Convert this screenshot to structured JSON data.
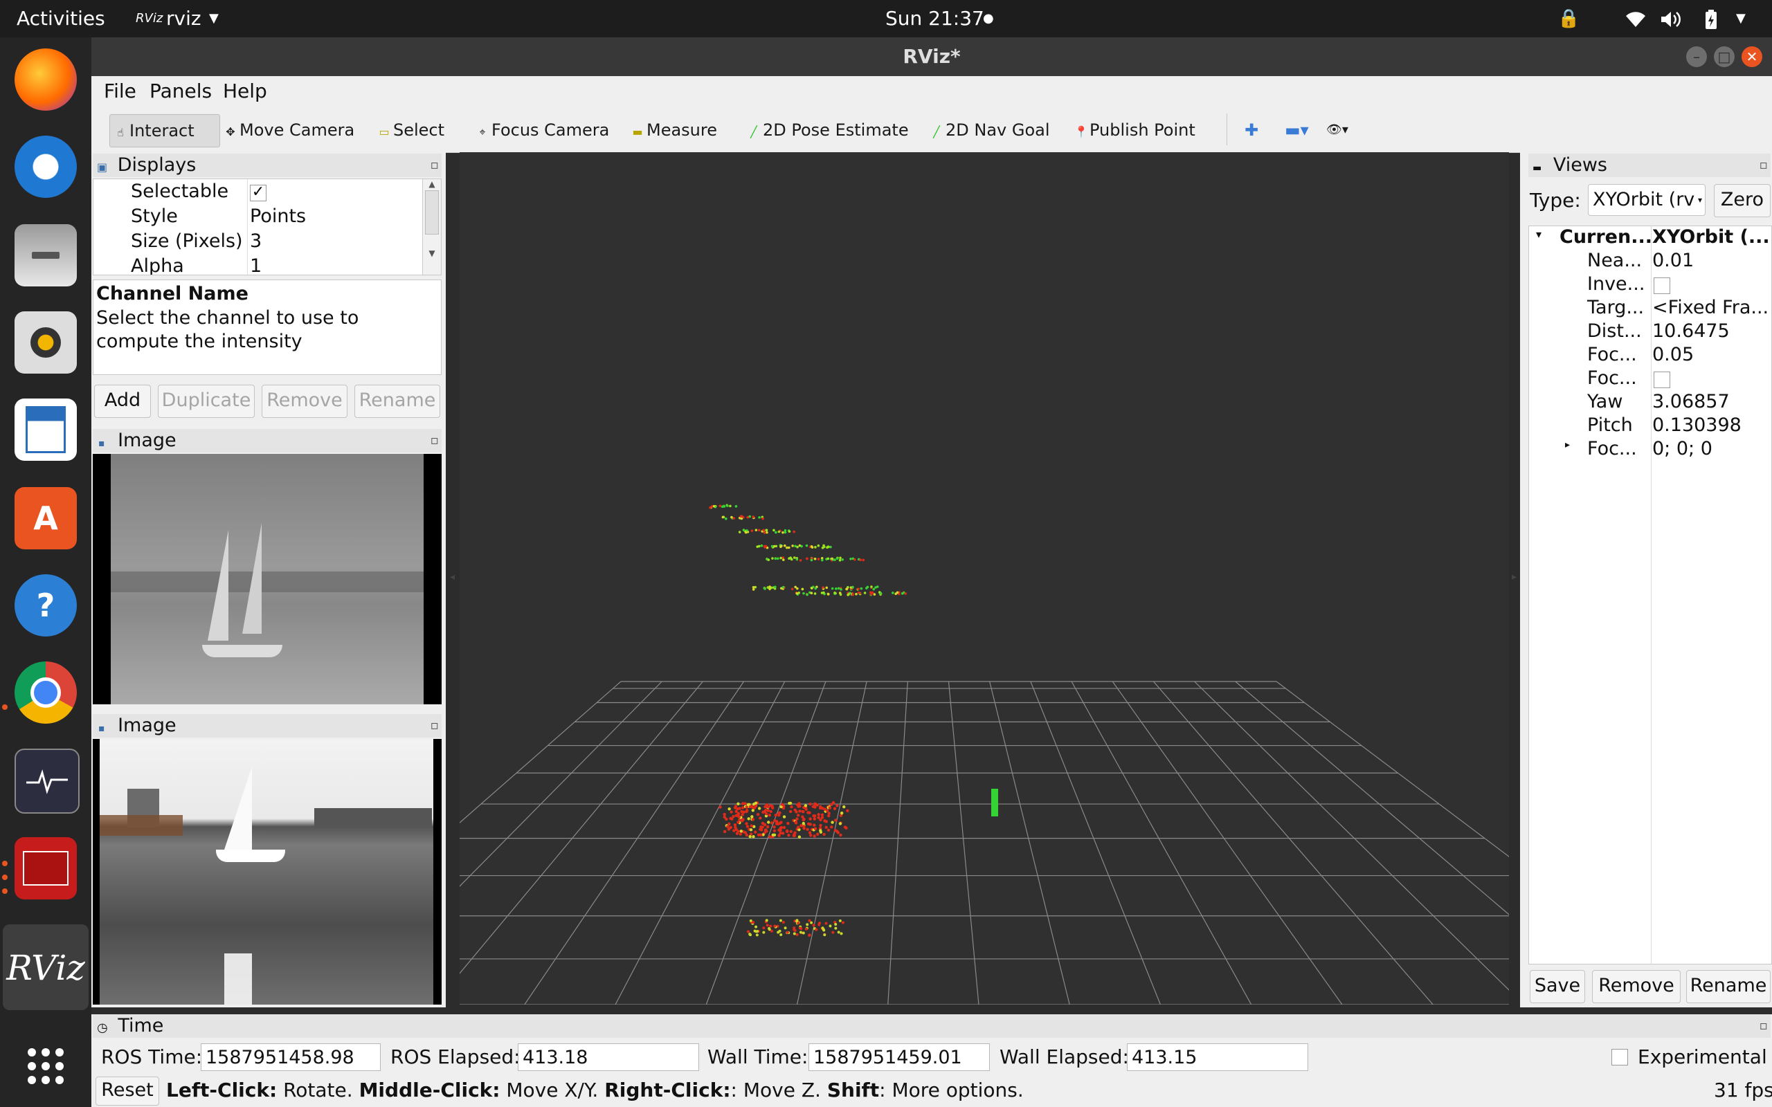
{
  "topbar": {
    "activities": "Activities",
    "app_icon_text": "RViz",
    "app_name": "rviz",
    "clock": "Sun 21:37"
  },
  "dock": {
    "items": [
      "firefox-icon",
      "thunderbird-icon",
      "files-icon",
      "rhythmbox-icon",
      "writer-icon",
      "software-icon",
      "help-icon",
      "chrome-icon",
      "system-monitor-icon",
      "terminal-icon",
      "rviz-icon",
      "show-apps-icon"
    ],
    "rviz_label": "RViz"
  },
  "window": {
    "title": "RViz*",
    "menu": [
      "File",
      "Panels",
      "Help"
    ]
  },
  "toolbar": {
    "interact": "Interact",
    "move_camera": "Move Camera",
    "select": "Select",
    "focus_camera": "Focus Camera",
    "measure": "Measure",
    "pose_estimate": "2D Pose Estimate",
    "nav_goal": "2D Nav Goal",
    "publish_point": "Publish Point"
  },
  "displays": {
    "title": "Displays",
    "rows": [
      {
        "name": "Selectable",
        "value": "✓"
      },
      {
        "name": "Style",
        "value": "Points"
      },
      {
        "name": "Size (Pixels)",
        "value": "3"
      },
      {
        "name": "Alpha",
        "value": "1"
      }
    ],
    "desc_title": "Channel Name",
    "desc_text": "Select the channel to use to compute the intensity",
    "buttons": {
      "add": "Add",
      "duplicate": "Duplicate",
      "remove": "Remove",
      "rename": "Rename"
    }
  },
  "image_panels": [
    {
      "title": "Image"
    },
    {
      "title": "Image"
    }
  ],
  "views": {
    "title": "Views",
    "type_label": "Type:",
    "type_value": "XYOrbit (rv",
    "zero": "Zero",
    "rows": [
      {
        "name": "Curren...",
        "value": "XYOrbit (..."
      },
      {
        "name": "Nea...",
        "value": "0.01"
      },
      {
        "name": "Inve...",
        "value": ""
      },
      {
        "name": "Targ...",
        "value": "<Fixed Fra..."
      },
      {
        "name": "Dist...",
        "value": "10.6475"
      },
      {
        "name": "Foc...",
        "value": "0.05"
      },
      {
        "name": "Foc...",
        "value": ""
      },
      {
        "name": "Yaw",
        "value": "3.06857"
      },
      {
        "name": "Pitch",
        "value": "0.130398"
      },
      {
        "name": "Foc...",
        "value": "0; 0; 0"
      }
    ],
    "buttons": {
      "save": "Save",
      "remove": "Remove",
      "rename": "Rename"
    }
  },
  "time": {
    "title": "Time",
    "ros_time_label": "ROS Time:",
    "ros_time": "1587951458.98",
    "ros_elapsed_label": "ROS Elapsed:",
    "ros_elapsed": "413.18",
    "wall_time_label": "Wall Time:",
    "wall_time": "1587951459.01",
    "wall_elapsed_label": "Wall Elapsed:",
    "wall_elapsed": "413.15",
    "experimental": "Experimental"
  },
  "status": {
    "reset": "Reset",
    "left": "Left-Click:",
    "left_desc": " Rotate. ",
    "middle": "Middle-Click:",
    "middle_desc": " Move X/Y. ",
    "right": "Right-Click:",
    "right_desc": ": Move Z. ",
    "shift": "Shift",
    "shift_desc": ": More options.",
    "fps": "31 fps"
  }
}
